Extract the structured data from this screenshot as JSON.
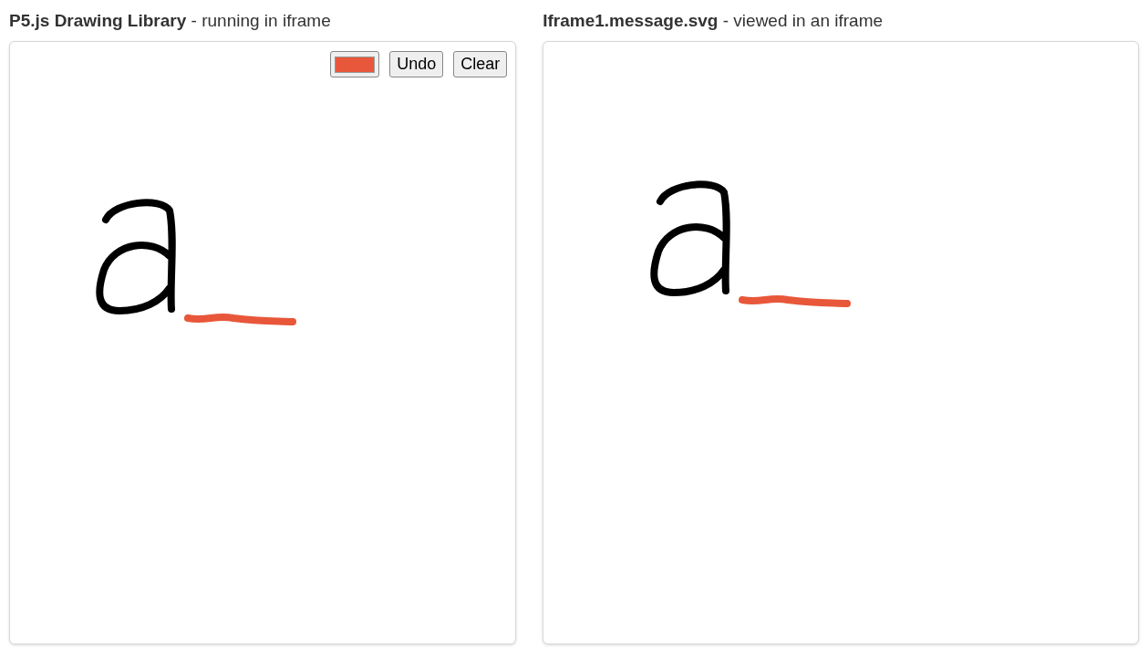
{
  "panels": [
    {
      "heading": "**P5.js Drawing Library** - running in iframe",
      "toolbar": {
        "color": "#e8573a",
        "buttons": [
          "Undo",
          "Clear"
        ]
      }
    },
    {
      "heading": "**Iframe1.message.svg** - viewed in an iframe"
    }
  ]
}
